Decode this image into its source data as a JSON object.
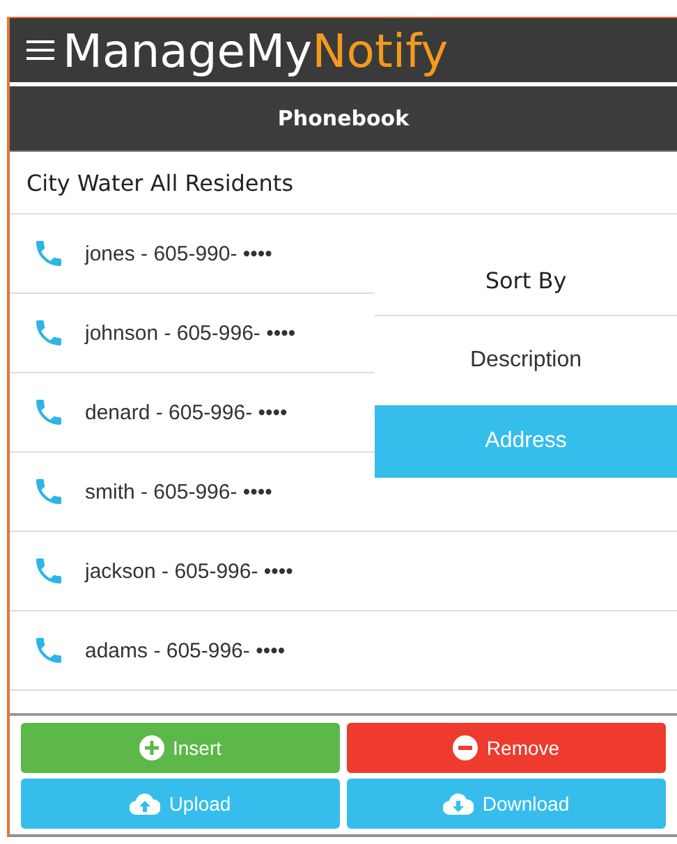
{
  "app_title": {
    "part_1": "ManageMy",
    "part_2": "Notify"
  },
  "page_title": "Phonebook",
  "group_title": "City Water All Residents",
  "contacts": [
    "jones - 605-990- ••••",
    "johnson - 605-996- ••••",
    "denard - 605-996- ••••",
    "smith - 605-996- ••••",
    "jackson - 605-996- ••••",
    "adams - 605-996- ••••"
  ],
  "sort_menu": {
    "title": "Sort By",
    "options": [
      {
        "label": "Description",
        "selected": false
      },
      {
        "label": "Address",
        "selected": true
      }
    ]
  },
  "buttons": [
    {
      "kind": "insert",
      "label": "Insert"
    },
    {
      "kind": "remove",
      "label": "Remove"
    },
    {
      "kind": "upload",
      "label": "Upload"
    },
    {
      "kind": "download",
      "label": "Download"
    }
  ]
}
